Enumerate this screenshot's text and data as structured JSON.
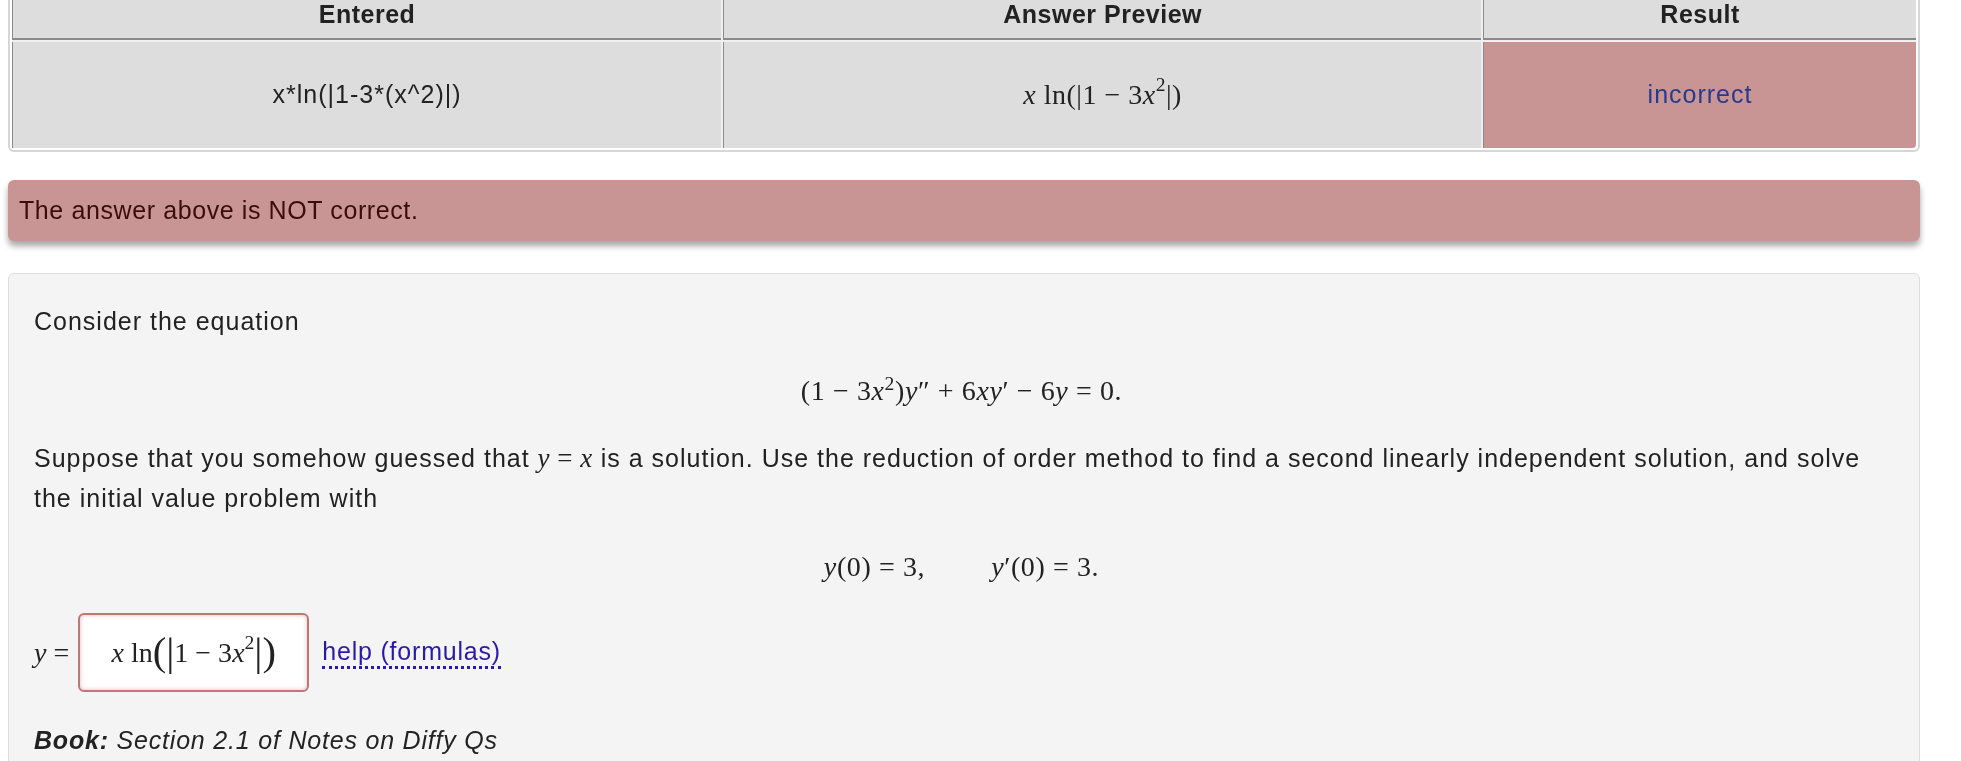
{
  "results_table": {
    "columns": [
      "Entered",
      "Answer Preview",
      "Result"
    ],
    "rows": [
      {
        "entered": "x*ln(|1-3*(x^2)|)",
        "preview": [
          {
            "kind": "it",
            "text": "x"
          },
          {
            "kind": "rm",
            "text": " ln(|1 − 3"
          },
          {
            "kind": "it",
            "text": "x"
          },
          {
            "kind": "sup",
            "text": "2"
          },
          {
            "kind": "rm",
            "text": "|)"
          }
        ],
        "result": "incorrect",
        "correct": false
      }
    ]
  },
  "feedback": {
    "kind": "error",
    "text": "The answer above is NOT correct."
  },
  "problem": {
    "blocks": [
      {
        "kind": "text",
        "parts": [
          {
            "kind": "text",
            "text": "Consider the equation"
          }
        ]
      },
      {
        "kind": "display",
        "items": [
          [
            {
              "kind": "rm",
              "text": "(1 − 3"
            },
            {
              "kind": "it",
              "text": "x"
            },
            {
              "kind": "sup",
              "text": "2"
            },
            {
              "kind": "rm",
              "text": ")"
            },
            {
              "kind": "it",
              "text": "y"
            },
            {
              "kind": "rm",
              "text": "″ + 6"
            },
            {
              "kind": "it",
              "text": "xy"
            },
            {
              "kind": "rm",
              "text": "′ − 6"
            },
            {
              "kind": "it",
              "text": "y"
            },
            {
              "kind": "rm",
              "text": " = 0."
            }
          ]
        ]
      },
      {
        "kind": "text",
        "parts": [
          {
            "kind": "text",
            "text": "Suppose that you somehow guessed that "
          },
          {
            "kind": "math",
            "tokens": [
              {
                "kind": "it",
                "text": "y"
              },
              {
                "kind": "rm",
                "text": " = "
              },
              {
                "kind": "it",
                "text": "x"
              }
            ]
          },
          {
            "kind": "text",
            "text": " is a solution. Use the reduction of order method to find a second linearly independent solution, and solve the initial value problem with"
          }
        ]
      },
      {
        "kind": "display",
        "items": [
          [
            {
              "kind": "it",
              "text": "y"
            },
            {
              "kind": "rm",
              "text": "(0) = 3,"
            }
          ],
          [
            {
              "kind": "it",
              "text": "y"
            },
            {
              "kind": "rm",
              "text": "′(0) = 3."
            }
          ]
        ]
      }
    ],
    "answer": {
      "label": [
        {
          "kind": "it",
          "text": "y"
        },
        {
          "kind": "rm",
          "text": " ="
        }
      ],
      "value": [
        {
          "kind": "it",
          "text": "x"
        },
        {
          "kind": "rm",
          "text": " ln"
        },
        {
          "kind": "big",
          "text": "("
        },
        {
          "kind": "big",
          "text": "|"
        },
        {
          "kind": "rm",
          "text": "1 − 3"
        },
        {
          "kind": "it",
          "text": "x"
        },
        {
          "kind": "sup",
          "text": "2"
        },
        {
          "kind": "big",
          "text": "|"
        },
        {
          "kind": "big",
          "text": ")"
        }
      ],
      "correct": false,
      "help_link": "help (formulas)"
    },
    "book": "**Book:** Section 2.1 of Notes on Diffy Qs"
  }
}
